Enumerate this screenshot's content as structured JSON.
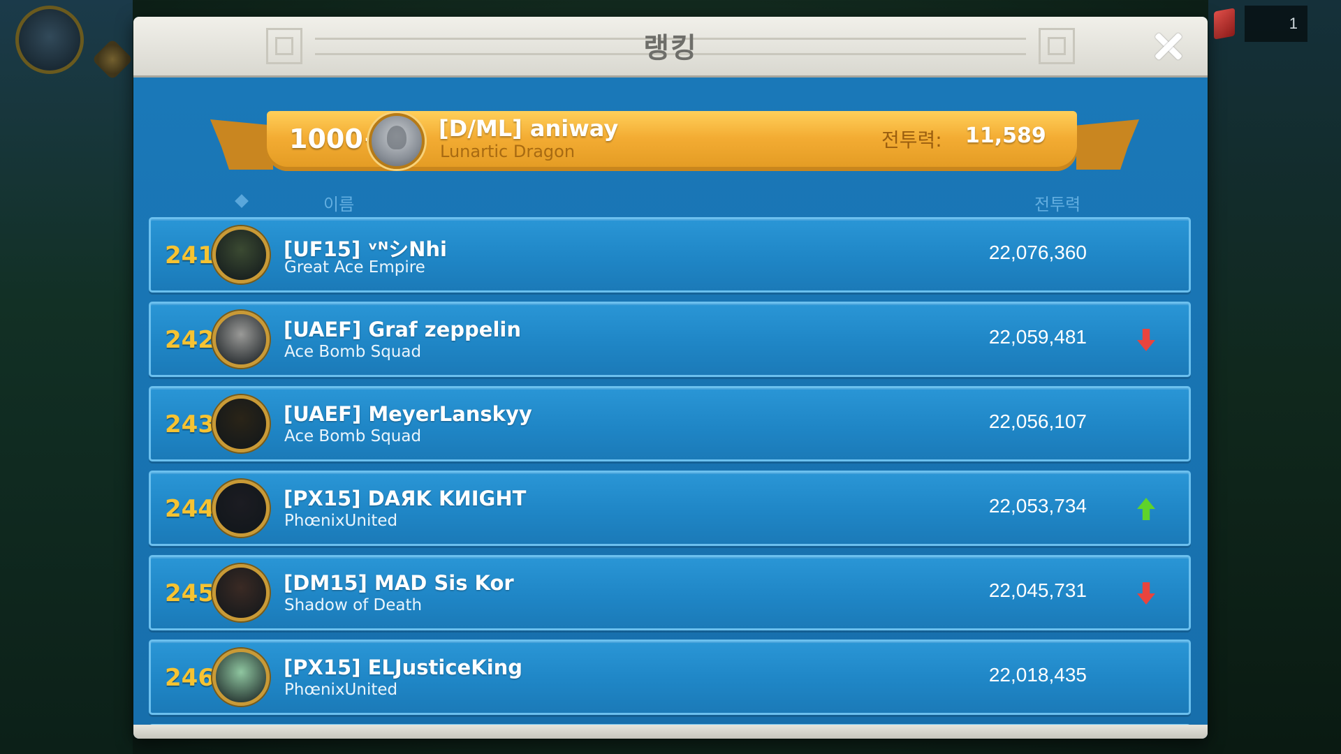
{
  "hud": {
    "gem_count": "1"
  },
  "dialog": {
    "title": "랭킹"
  },
  "my_rank": {
    "rank": "1000+",
    "name": "[D/ML] aniway",
    "alliance": "Lunartic Dragon",
    "power_label": "전투력:",
    "power_value": "11,589"
  },
  "columns": {
    "name": "이름",
    "power": "전투력"
  },
  "rows": [
    {
      "rank": "241",
      "name": "[UF15] ᵛᴺシNhi",
      "alliance": "Great Ace Empire",
      "power": "22,076,360",
      "trend": "none",
      "avatar_color": "#3b4a32"
    },
    {
      "rank": "242",
      "name": "[UAEF] Graf zeppelin",
      "alliance": "Ace Bomb Squad",
      "power": "22,059,481",
      "trend": "down",
      "avatar_color": "#9a9a98"
    },
    {
      "rank": "243",
      "name": "[UAEF] MeyerLanskyy",
      "alliance": "Ace Bomb Squad",
      "power": "22,056,107",
      "trend": "none",
      "avatar_color": "#2a2418"
    },
    {
      "rank": "244",
      "name": "[PX15] DAЯK KИIGHT",
      "alliance": "PhœnixUnited",
      "power": "22,053,734",
      "trend": "up",
      "avatar_color": "#1c1c22"
    },
    {
      "rank": "245",
      "name": "[DM15] MAD Sis Kor",
      "alliance": "Shadow of Death",
      "power": "22,045,731",
      "trend": "down",
      "avatar_color": "#3a2a24"
    },
    {
      "rank": "246",
      "name": "[PX15] ELJusticeKing",
      "alliance": "PhœnixUnited",
      "power": "22,018,435",
      "trend": "none",
      "avatar_color": "#8fc6a0"
    }
  ]
}
